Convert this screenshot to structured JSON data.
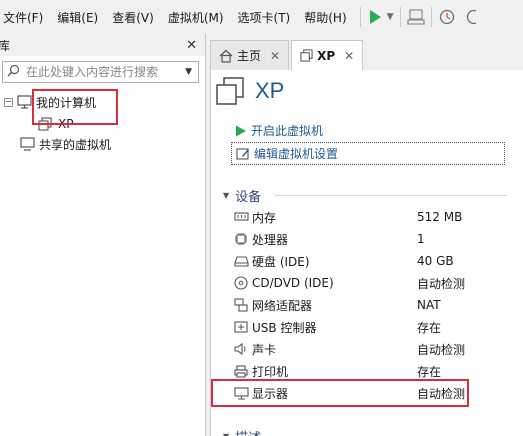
{
  "menu": {
    "items": [
      "文件(F)",
      "编辑(E)",
      "查看(V)",
      "虚拟机(M)",
      "选项卡(T)",
      "帮助(H)"
    ]
  },
  "toolbar": {
    "icons": [
      "play-icon",
      "dropdown-icon",
      "send-keys-icon",
      "snapshot-icon",
      "snapshot-manager-icon"
    ]
  },
  "library": {
    "title": "库",
    "close": "✕",
    "search_placeholder": "在此处键入内容进行搜索",
    "tree": [
      {
        "label": "我的计算机"
      },
      {
        "label": "XP"
      },
      {
        "label": "共享的虚拟机"
      }
    ]
  },
  "tabs": [
    {
      "label": "主页",
      "close": "✕"
    },
    {
      "label": "XP",
      "close": "✕"
    }
  ],
  "vm": {
    "name": "XP",
    "actions": {
      "power_on": "开启此虚拟机",
      "edit_settings": "编辑虚拟机设置"
    },
    "devices_section": "设备",
    "devices": [
      {
        "label": "内存",
        "value": "512 MB",
        "icon": "memory-icon"
      },
      {
        "label": "处理器",
        "value": "1",
        "icon": "cpu-icon"
      },
      {
        "label": "硬盘 (IDE)",
        "value": "40 GB",
        "icon": "hard-disk-icon"
      },
      {
        "label": "CD/DVD (IDE)",
        "value": "自动检测",
        "icon": "cd-dvd-icon"
      },
      {
        "label": "网络适配器",
        "value": "NAT",
        "icon": "network-adapter-icon"
      },
      {
        "label": "USB 控制器",
        "value": "存在",
        "icon": "usb-icon"
      },
      {
        "label": "声卡",
        "value": "自动检测",
        "icon": "speaker-icon"
      },
      {
        "label": "打印机",
        "value": "存在",
        "icon": "printer-icon"
      },
      {
        "label": "显示器",
        "value": "自动检测",
        "icon": "monitor-icon"
      }
    ],
    "description_section": "描述"
  },
  "colors": {
    "highlight": "#d62f3b",
    "play_green": "#2fa84f",
    "link_blue": "#1f5a92"
  }
}
